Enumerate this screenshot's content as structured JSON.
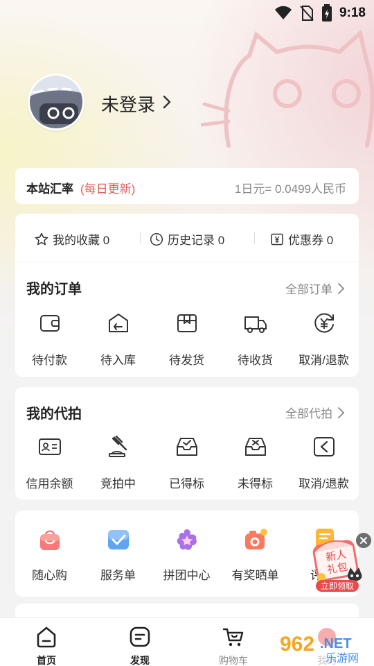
{
  "status": {
    "time": "9:18"
  },
  "profile": {
    "login_label": "未登录"
  },
  "exchange": {
    "label": "本站汇率",
    "tag": "(每日更新)",
    "value": "1日元= 0.0499人民币"
  },
  "shortcuts": [
    {
      "label": "我的收藏 0",
      "icon": "star-icon"
    },
    {
      "label": "历史记录 0",
      "icon": "clock-icon"
    },
    {
      "label": "优惠券 0",
      "icon": "coupon-icon"
    }
  ],
  "orders": {
    "title": "我的订单",
    "link": "全部订单",
    "items": [
      {
        "label": "待付款",
        "icon": "wallet-icon"
      },
      {
        "label": "待入库",
        "icon": "warehouse-icon"
      },
      {
        "label": "待发货",
        "icon": "box-icon"
      },
      {
        "label": "待收货",
        "icon": "truck-icon"
      },
      {
        "label": "取消/退款",
        "icon": "refund-icon"
      }
    ]
  },
  "bids": {
    "title": "我的代拍",
    "link": "全部代拍",
    "items": [
      {
        "label": "信用余额",
        "icon": "id-card-icon"
      },
      {
        "label": "竞拍中",
        "icon": "gavel-icon"
      },
      {
        "label": "已得标",
        "icon": "inbox-check-icon"
      },
      {
        "label": "未得标",
        "icon": "inbox-x-icon"
      },
      {
        "label": "取消/退款",
        "icon": "return-icon"
      }
    ]
  },
  "tools": {
    "items": [
      {
        "label": "随心购",
        "icon": "bag-icon"
      },
      {
        "label": "服务单",
        "icon": "service-icon"
      },
      {
        "label": "拼团中心",
        "icon": "group-icon"
      },
      {
        "label": "有奖晒单",
        "icon": "camera-icon"
      },
      {
        "label": "评",
        "icon": "review-icon"
      }
    ]
  },
  "gift": {
    "line1": "新人",
    "line2": "礼包",
    "button": "立即领取"
  },
  "nav": [
    {
      "label": "首页",
      "icon": "home-icon",
      "active": true
    },
    {
      "label": "发现",
      "icon": "discover-icon",
      "active": true
    },
    {
      "label": "购物车",
      "icon": "cart-icon",
      "active": false
    },
    {
      "label": "我的",
      "icon": "user-icon",
      "active": false
    }
  ],
  "watermark": {
    "brand": "962",
    "domain": ".NET",
    "text": "乐游网"
  },
  "colors": {
    "accent": "#e75a52",
    "text": "#222222",
    "muted": "#888888"
  }
}
